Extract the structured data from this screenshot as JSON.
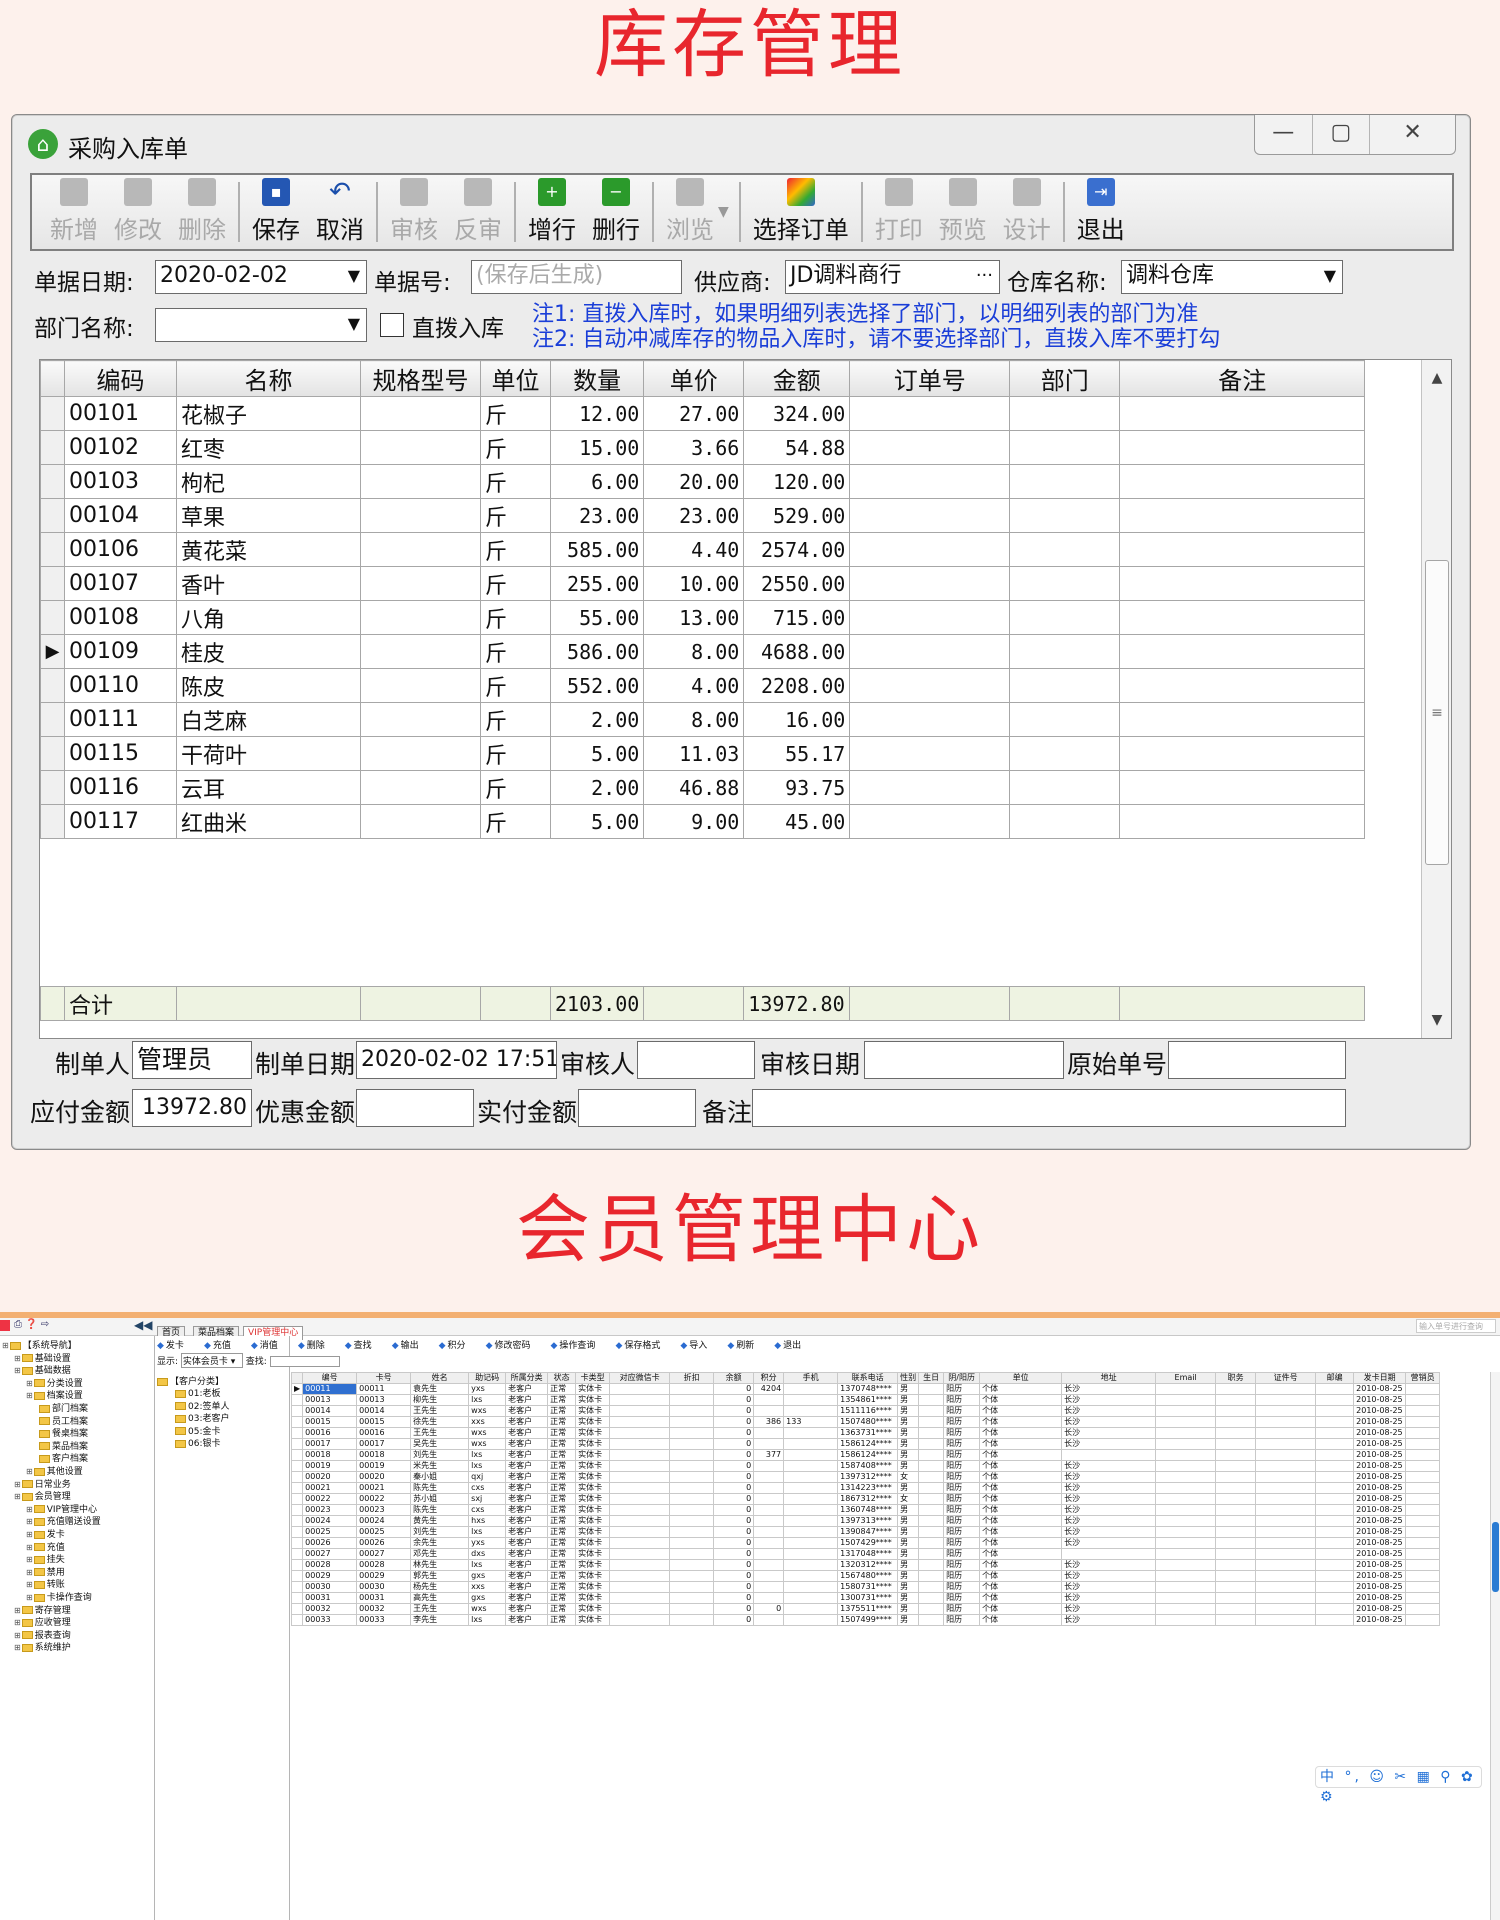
{
  "banner_top": "库存管理",
  "banner_bottom": "会员管理中心",
  "window1": {
    "title": "采购入库单",
    "window_buttons": [
      "—",
      "▢",
      "✕"
    ],
    "toolbar": [
      {
        "label": "新增",
        "enabled": false,
        "icon": "new-doc-icon"
      },
      {
        "label": "修改",
        "enabled": false,
        "icon": "edit-doc-icon"
      },
      {
        "label": "删除",
        "enabled": false,
        "icon": "delete-doc-icon"
      },
      {
        "label": "保存",
        "enabled": true,
        "icon": "save-icon"
      },
      {
        "label": "取消",
        "enabled": true,
        "icon": "undo-icon"
      },
      {
        "label": "审核",
        "enabled": false,
        "icon": "spellcheck-icon"
      },
      {
        "label": "反审",
        "enabled": false,
        "icon": "unapprove-icon"
      },
      {
        "label": "增行",
        "enabled": true,
        "icon": "add-row-icon"
      },
      {
        "label": "删行",
        "enabled": true,
        "icon": "delete-row-icon"
      },
      {
        "label": "浏览",
        "enabled": false,
        "icon": "browse-icon"
      },
      {
        "label": "选择订单",
        "enabled": true,
        "icon": "select-order-icon"
      },
      {
        "label": "打印",
        "enabled": false,
        "icon": "print-icon"
      },
      {
        "label": "预览",
        "enabled": false,
        "icon": "preview-icon"
      },
      {
        "label": "设计",
        "enabled": false,
        "icon": "design-icon"
      },
      {
        "label": "退出",
        "enabled": true,
        "icon": "exit-icon"
      }
    ],
    "form": {
      "date_label": "单据日期:",
      "date_value": "2020-02-02",
      "docno_label": "单据号:",
      "docno_placeholder": "(保存后生成)",
      "supplier_label": "供应商:",
      "supplier_value": "JD调料商行",
      "supplier_ellipsis": "···",
      "warehouse_label": "仓库名称:",
      "warehouse_value": "调料仓库",
      "dept_label": "部门名称:",
      "dept_value": "",
      "direct_label": "直拨入库",
      "direct_checked": false,
      "note1": "注1: 直拨入库时，如果明细列表选择了部门，以明细列表的部门为准",
      "note2": "注2: 自动冲减库存的物品入库时，请不要选择部门，直拨入库不要打勾"
    },
    "grid": {
      "columns": [
        "编码",
        "名称",
        "规格型号",
        "单位",
        "数量",
        "单价",
        "金额",
        "订单号",
        "部门",
        "备注"
      ],
      "rows": [
        {
          "code": "00101",
          "name": "花椒子",
          "spec": "",
          "unit": "斤",
          "qty": "12.00",
          "price": "27.00",
          "amount": "324.00"
        },
        {
          "code": "00102",
          "name": "红枣",
          "spec": "",
          "unit": "斤",
          "qty": "15.00",
          "price": "3.66",
          "amount": "54.88"
        },
        {
          "code": "00103",
          "name": "枸杞",
          "spec": "",
          "unit": "斤",
          "qty": "6.00",
          "price": "20.00",
          "amount": "120.00"
        },
        {
          "code": "00104",
          "name": "草果",
          "spec": "",
          "unit": "斤",
          "qty": "23.00",
          "price": "23.00",
          "amount": "529.00"
        },
        {
          "code": "00106",
          "name": "黄花菜",
          "spec": "",
          "unit": "斤",
          "qty": "585.00",
          "price": "4.40",
          "amount": "2574.00"
        },
        {
          "code": "00107",
          "name": "香叶",
          "spec": "",
          "unit": "斤",
          "qty": "255.00",
          "price": "10.00",
          "amount": "2550.00"
        },
        {
          "code": "00108",
          "name": "八角",
          "spec": "",
          "unit": "斤",
          "qty": "55.00",
          "price": "13.00",
          "amount": "715.00"
        },
        {
          "code": "00109",
          "name": "桂皮",
          "spec": "",
          "unit": "斤",
          "qty": "586.00",
          "price": "8.00",
          "amount": "4688.00",
          "current": true
        },
        {
          "code": "00110",
          "name": "陈皮",
          "spec": "",
          "unit": "斤",
          "qty": "552.00",
          "price": "4.00",
          "amount": "2208.00"
        },
        {
          "code": "00111",
          "name": "白芝麻",
          "spec": "",
          "unit": "斤",
          "qty": "2.00",
          "price": "8.00",
          "amount": "16.00"
        },
        {
          "code": "00115",
          "name": "干荷叶",
          "spec": "",
          "unit": "斤",
          "qty": "5.00",
          "price": "11.03",
          "amount": "55.17"
        },
        {
          "code": "00116",
          "name": "云耳",
          "spec": "",
          "unit": "斤",
          "qty": "2.00",
          "price": "46.88",
          "amount": "93.75"
        },
        {
          "code": "00117",
          "name": "红曲米",
          "spec": "",
          "unit": "斤",
          "qty": "5.00",
          "price": "9.00",
          "amount": "45.00"
        }
      ],
      "total_label": "合计",
      "total_qty": "2103.00",
      "total_amount": "13972.80"
    },
    "footer": {
      "maker_label": "制单人",
      "maker_value": "管理员",
      "make_date_label": "制单日期",
      "make_date_value": "2020-02-02 17:51",
      "auditor_label": "审核人",
      "auditor_value": "",
      "audit_date_label": "审核日期",
      "audit_date_value": "",
      "origin_no_label": "原始单号",
      "origin_no_value": "",
      "payable_label": "应付金额",
      "payable_value": "13972.80",
      "discount_label": "优惠金额",
      "discount_value": "",
      "paid_label": "实付金额",
      "paid_value": "",
      "remark_label": "备注",
      "remark_value": ""
    }
  },
  "window2": {
    "search_placeholder": "输入单号进行查询",
    "tabs": [
      "首页",
      "菜品档案",
      "VIP管理中心"
    ],
    "toolbar": [
      "发卡",
      "充值",
      "消值",
      "删除",
      "查找",
      "输出",
      "积分",
      "修改密码",
      "操作查询",
      "保存格式",
      "导入",
      "刷新",
      "退出"
    ],
    "filter_label": "显示:",
    "filter_value": "实体会员卡",
    "search_label": "查找:",
    "nav_tree": [
      {
        "t": "【系统导航】",
        "lvl": 0
      },
      {
        "t": "基础设置",
        "lvl": 1
      },
      {
        "t": "基础数据",
        "lvl": 1
      },
      {
        "t": "分类设置",
        "lvl": 2
      },
      {
        "t": "档案设置",
        "lvl": 2
      },
      {
        "t": "部门档案",
        "lvl": 3
      },
      {
        "t": "员工档案",
        "lvl": 3
      },
      {
        "t": "餐桌档案",
        "lvl": 3
      },
      {
        "t": "菜品档案",
        "lvl": 3
      },
      {
        "t": "客户档案",
        "lvl": 3
      },
      {
        "t": "其他设置",
        "lvl": 2
      },
      {
        "t": "日常业务",
        "lvl": 1
      },
      {
        "t": "会员管理",
        "lvl": 1
      },
      {
        "t": "VIP管理中心",
        "lvl": 2
      },
      {
        "t": "充值赠送设置",
        "lvl": 2
      },
      {
        "t": "发卡",
        "lvl": 2
      },
      {
        "t": "充值",
        "lvl": 2
      },
      {
        "t": "挂失",
        "lvl": 2
      },
      {
        "t": "禁用",
        "lvl": 2
      },
      {
        "t": "转账",
        "lvl": 2
      },
      {
        "t": "卡操作查询",
        "lvl": 2
      },
      {
        "t": "寄存管理",
        "lvl": 1
      },
      {
        "t": "应收管理",
        "lvl": 1
      },
      {
        "t": "报表查询",
        "lvl": 1
      },
      {
        "t": "系统维护",
        "lvl": 1
      }
    ],
    "class_tree": [
      "【客户分类】",
      "01:老板",
      "02:签单人",
      "03:老客户",
      "05:金卡",
      "06:银卡"
    ],
    "columns": [
      "编号",
      "卡号",
      "姓名",
      "助记码",
      "所属分类",
      "状态",
      "卡类型",
      "对应微信卡",
      "折扣",
      "余额",
      "积分",
      "手机",
      "联系电话",
      "性别",
      "生日",
      "阴/阳历",
      "单位",
      "地址",
      "Email",
      "职务",
      "证件号",
      "邮编",
      "发卡日期",
      "营销员"
    ],
    "rows": [
      [
        "00011",
        "00011",
        "袁先生",
        "yxs",
        "老客户",
        "正常",
        "实体卡",
        "",
        "",
        "0",
        "4204",
        "",
        "1370748****",
        "男",
        "",
        "阳历",
        "个体",
        "长沙",
        "",
        "",
        "",
        "",
        "2010-08-25",
        ""
      ],
      [
        "00013",
        "00013",
        "柳先生",
        "lxs",
        "老客户",
        "正常",
        "实体卡",
        "",
        "",
        "0",
        "",
        "",
        "1354861****",
        "男",
        "",
        "阳历",
        "个体",
        "长沙",
        "",
        "",
        "",
        "",
        "2010-08-25",
        ""
      ],
      [
        "00014",
        "00014",
        "王先生",
        "wxs",
        "老客户",
        "正常",
        "实体卡",
        "",
        "",
        "0",
        "",
        "",
        "1511116****",
        "男",
        "",
        "阳历",
        "个体",
        "长沙",
        "",
        "",
        "",
        "",
        "2010-08-25",
        ""
      ],
      [
        "00015",
        "00015",
        "徐先生",
        "xxs",
        "老客户",
        "正常",
        "实体卡",
        "",
        "",
        "0",
        "386",
        "133",
        "1507480****",
        "男",
        "",
        "阳历",
        "个体",
        "长沙",
        "",
        "",
        "",
        "",
        "2010-08-25",
        ""
      ],
      [
        "00016",
        "00016",
        "王先生",
        "wxs",
        "老客户",
        "正常",
        "实体卡",
        "",
        "",
        "0",
        "",
        "",
        "1363731****",
        "男",
        "",
        "阳历",
        "个体",
        "长沙",
        "",
        "",
        "",
        "",
        "2010-08-25",
        ""
      ],
      [
        "00017",
        "00017",
        "吴先生",
        "wxs",
        "老客户",
        "正常",
        "实体卡",
        "",
        "",
        "0",
        "",
        "",
        "1586124****",
        "男",
        "",
        "阳历",
        "个体",
        "长沙",
        "",
        "",
        "",
        "",
        "2010-08-25",
        ""
      ],
      [
        "00018",
        "00018",
        "刘先生",
        "lxs",
        "老客户",
        "正常",
        "实体卡",
        "",
        "",
        "0",
        "377",
        "",
        "1586124****",
        "男",
        "",
        "阳历",
        "个体",
        "",
        "",
        "",
        "",
        "",
        "2010-08-25",
        ""
      ],
      [
        "00019",
        "00019",
        "米先生",
        "lxs",
        "老客户",
        "正常",
        "实体卡",
        "",
        "",
        "0",
        "",
        "",
        "1587408****",
        "男",
        "",
        "阳历",
        "个体",
        "长沙",
        "",
        "",
        "",
        "",
        "2010-08-25",
        ""
      ],
      [
        "00020",
        "00020",
        "秦小姐",
        "qxj",
        "老客户",
        "正常",
        "实体卡",
        "",
        "",
        "0",
        "",
        "",
        "1397312****",
        "女",
        "",
        "阳历",
        "个体",
        "长沙",
        "",
        "",
        "",
        "",
        "2010-08-25",
        ""
      ],
      [
        "00021",
        "00021",
        "陈先生",
        "cxs",
        "老客户",
        "正常",
        "实体卡",
        "",
        "",
        "0",
        "",
        "",
        "1314223****",
        "男",
        "",
        "阳历",
        "个体",
        "长沙",
        "",
        "",
        "",
        "",
        "2010-08-25",
        ""
      ],
      [
        "00022",
        "00022",
        "苏小姐",
        "sxj",
        "老客户",
        "正常",
        "实体卡",
        "",
        "",
        "0",
        "",
        "",
        "1867312****",
        "女",
        "",
        "阳历",
        "个体",
        "长沙",
        "",
        "",
        "",
        "",
        "2010-08-25",
        ""
      ],
      [
        "00023",
        "00023",
        "陈先生",
        "cxs",
        "老客户",
        "正常",
        "实体卡",
        "",
        "",
        "0",
        "",
        "",
        "1360748****",
        "男",
        "",
        "阳历",
        "个体",
        "长沙",
        "",
        "",
        "",
        "",
        "2010-08-25",
        ""
      ],
      [
        "00024",
        "00024",
        "黄先生",
        "hxs",
        "老客户",
        "正常",
        "实体卡",
        "",
        "",
        "0",
        "",
        "",
        "1397313****",
        "男",
        "",
        "阳历",
        "个体",
        "长沙",
        "",
        "",
        "",
        "",
        "2010-08-25",
        ""
      ],
      [
        "00025",
        "00025",
        "刘先生",
        "lxs",
        "老客户",
        "正常",
        "实体卡",
        "",
        "",
        "0",
        "",
        "",
        "1390847****",
        "男",
        "",
        "阳历",
        "个体",
        "长沙",
        "",
        "",
        "",
        "",
        "2010-08-25",
        ""
      ],
      [
        "00026",
        "00026",
        "余先生",
        "yxs",
        "老客户",
        "正常",
        "实体卡",
        "",
        "",
        "0",
        "",
        "",
        "1507429****",
        "男",
        "",
        "阳历",
        "个体",
        "长沙",
        "",
        "",
        "",
        "",
        "2010-08-25",
        ""
      ],
      [
        "00027",
        "00027",
        "邓先生",
        "dxs",
        "老客户",
        "正常",
        "实体卡",
        "",
        "",
        "0",
        "",
        "",
        "1317048****",
        "男",
        "",
        "阳历",
        "个体",
        "",
        "",
        "",
        "",
        "",
        "2010-08-25",
        ""
      ],
      [
        "00028",
        "00028",
        "林先生",
        "lxs",
        "老客户",
        "正常",
        "实体卡",
        "",
        "",
        "0",
        "",
        "",
        "1320312****",
        "男",
        "",
        "阳历",
        "个体",
        "长沙",
        "",
        "",
        "",
        "",
        "2010-08-25",
        ""
      ],
      [
        "00029",
        "00029",
        "郭先生",
        "gxs",
        "老客户",
        "正常",
        "实体卡",
        "",
        "",
        "0",
        "",
        "",
        "1567480****",
        "男",
        "",
        "阳历",
        "个体",
        "长沙",
        "",
        "",
        "",
        "",
        "2010-08-25",
        ""
      ],
      [
        "00030",
        "00030",
        "杨先生",
        "xxs",
        "老客户",
        "正常",
        "实体卡",
        "",
        "",
        "0",
        "",
        "",
        "1580731****",
        "男",
        "",
        "阳历",
        "个体",
        "长沙",
        "",
        "",
        "",
        "",
        "2010-08-25",
        ""
      ],
      [
        "00031",
        "00031",
        "高先生",
        "gxs",
        "老客户",
        "正常",
        "实体卡",
        "",
        "",
        "0",
        "",
        "",
        "1300731****",
        "男",
        "",
        "阳历",
        "个体",
        "长沙",
        "",
        "",
        "",
        "",
        "2010-08-25",
        ""
      ],
      [
        "00032",
        "00032",
        "王先生",
        "wxs",
        "老客户",
        "正常",
        "实体卡",
        "",
        "",
        "0",
        "0",
        "",
        "1375511****",
        "男",
        "",
        "阳历",
        "个体",
        "长沙",
        "",
        "",
        "",
        "",
        "2010-08-25",
        ""
      ],
      [
        "00033",
        "00033",
        "李先生",
        "lxs",
        "老客户",
        "正常",
        "实体卡",
        "",
        "",
        "0",
        "",
        "",
        "1507499****",
        "男",
        "",
        "阳历",
        "个体",
        "长沙",
        "",
        "",
        "",
        "",
        "2010-08-25",
        ""
      ]
    ],
    "ime_bar": "中 °, ☺ ✂ ▦ ⚲ ✿ ⚙"
  }
}
